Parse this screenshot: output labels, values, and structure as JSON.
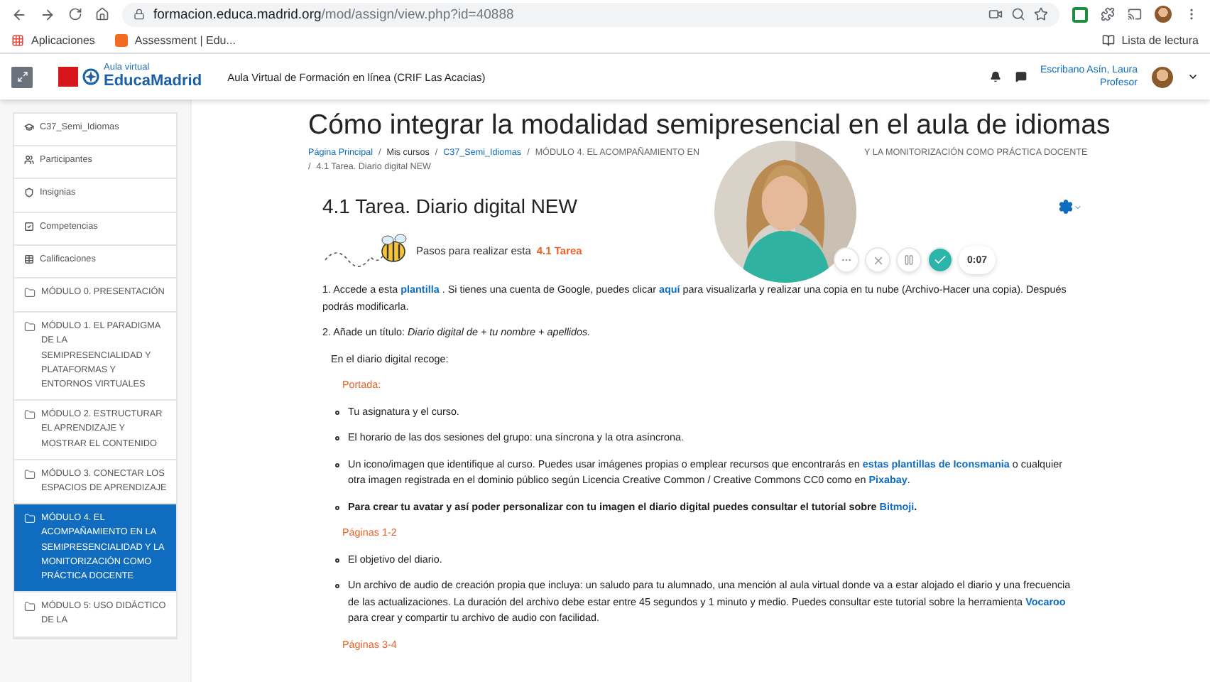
{
  "browser": {
    "url_domain": "formacion.educa.madrid.org",
    "url_path": "/mod/assign/view.php?id=40888",
    "bookmarks": [
      {
        "label": "Aplicaciones",
        "kind": "apps"
      },
      {
        "label": "Assessment | Edu...",
        "kind": "site"
      }
    ],
    "reading_list": "Lista de lectura"
  },
  "navbar": {
    "logo_small": "Aula virtual",
    "logo_big": "EducaMadrid",
    "site_name": "Aula Virtual de Formación en línea (CRIF Las Acacias)",
    "user_name": "Escribano Asín, Laura",
    "user_role": "Profesor"
  },
  "sidebar": {
    "items": [
      {
        "label": "C37_Semi_Idiomas",
        "kind": "course",
        "selected": false
      },
      {
        "label": "Participantes",
        "kind": "people",
        "selected": false
      },
      {
        "label": "Insignias",
        "kind": "badge",
        "selected": false
      },
      {
        "label": "Competencias",
        "kind": "check",
        "selected": false
      },
      {
        "label": "Calificaciones",
        "kind": "grades",
        "selected": false
      },
      {
        "label": "MÓDULO 0. PRESENTACIÓN",
        "kind": "folder",
        "selected": false
      },
      {
        "label": "MÓDULO 1. EL PARADIGMA DE LA SEMIPRESENCIALIDAD Y PLATAFORMAS Y ENTORNOS VIRTUALES",
        "kind": "folder",
        "selected": false
      },
      {
        "label": "MÓDULO 2. ESTRUCTURAR EL APRENDIZAJE Y MOSTRAR EL CONTENIDO",
        "kind": "folder",
        "selected": false
      },
      {
        "label": "MÓDULO 3. CONECTAR LOS ESPACIOS DE APRENDIZAJE",
        "kind": "folder",
        "selected": false
      },
      {
        "label": "MÓDULO 4. EL ACOMPAÑAMIENTO EN LA SEMIPRESENCIALIDAD Y LA MONITORIZACIÓN COMO PRÁCTICA DOCENTE",
        "kind": "folder",
        "selected": true
      },
      {
        "label": "MÓDULO 5: USO DIDÁCTICO DE LA",
        "kind": "folder",
        "selected": false
      }
    ]
  },
  "page": {
    "title": "Cómo integrar la modalidad semipresencial en el aula de idiomas",
    "breadcrumb_separator": "/",
    "breadcrumb": [
      {
        "label": "Página Principal",
        "kind": "link"
      },
      {
        "label": "Mis cursos",
        "kind": "plain"
      },
      {
        "label": "C37_Semi_Idiomas",
        "kind": "link"
      },
      {
        "label": "MÓDULO 4. EL ACOMPAÑAMIENTO EN",
        "kind": "muted"
      },
      {
        "label": "Y LA MONITORIZACIÓN COMO PRÁCTICA DOCENTE",
        "kind": "tail"
      },
      {
        "label": "4.1 Tarea. Diario digital NEW",
        "kind": "muted"
      }
    ],
    "activity_title": "4.1 Tarea. Diario digital NEW",
    "steps_text": "Pasos para realizar esta",
    "steps_link": "4.1 Tarea",
    "blocks": [
      {
        "kind": "para",
        "segments": [
          {
            "kind": "text",
            "text": "1. Accede a esta"
          },
          {
            "kind": "link",
            "text": "plantilla"
          },
          {
            "kind": "text",
            "text": ". Si tienes una cuenta de Google, puedes clicar"
          },
          {
            "kind": "link",
            "text": "aquí"
          },
          {
            "kind": "text",
            "text": "para visualizarla y realizar una copia en tu nube (Archivo-Hacer una copia). Después podrás modificarla."
          }
        ]
      },
      {
        "kind": "para",
        "segments": [
          {
            "kind": "text",
            "text": "2. Añade un título:"
          },
          {
            "kind": "em",
            "text": "Diario digital de + tu nombre + apellidos."
          }
        ]
      },
      {
        "kind": "sub",
        "segments": [
          {
            "kind": "text",
            "text": "En el diario digital recoge:"
          }
        ]
      },
      {
        "kind": "heading",
        "segments": [
          {
            "kind": "text",
            "text": "Portada:"
          }
        ]
      },
      {
        "kind": "bullet",
        "segments": [
          {
            "kind": "text",
            "text": "Tu asignatura y el curso."
          }
        ]
      },
      {
        "kind": "bullet",
        "segments": [
          {
            "kind": "text",
            "text": "El horario de las dos sesiones del grupo: una síncrona y  la otra asíncrona."
          }
        ]
      },
      {
        "kind": "bullet",
        "segments": [
          {
            "kind": "text",
            "text": "Un icono/imagen que identifique al curso. Puedes usar imágenes propias o emplear recursos  que encontrarás en"
          },
          {
            "kind": "link",
            "text": "estas plantillas de Iconsmania"
          },
          {
            "kind": "text",
            "text": "o cualquier otra imagen registrada en el dominio público según Licencia Creative Common / Creative Commons CC0 como en"
          },
          {
            "kind": "link",
            "text": "Pixabay"
          },
          {
            "kind": "text",
            "text": "."
          }
        ]
      },
      {
        "kind": "boldbullet",
        "segments": [
          {
            "kind": "text",
            "text": "Para crear tu avatar y así poder personalizar con tu imagen el diario digital puedes consultar el tutorial sobre"
          },
          {
            "kind": "link",
            "text": "Bitmoji"
          },
          {
            "kind": "text",
            "text": "."
          }
        ]
      },
      {
        "kind": "heading",
        "segments": [
          {
            "kind": "text",
            "text": "Páginas 1-2"
          }
        ]
      },
      {
        "kind": "bullet",
        "segments": [
          {
            "kind": "text",
            "text": "El objetivo del diario."
          }
        ]
      },
      {
        "kind": "bullet",
        "segments": [
          {
            "kind": "text",
            "text": "Un archivo de audio de creación propia que incluya:  un saludo para tu alumnado, una mención al aula virtual donde va a estar alojado el diario y una frecuencia de las actualizaciones. La duración del archivo debe estar entre 45 segundos y 1 minuto y medio. Puedes consultar este tutorial sobre la herramienta"
          },
          {
            "kind": "link",
            "text": "Vocaroo"
          },
          {
            "kind": "text",
            "text": "para crear y compartir tu archivo de audio con facilidad."
          }
        ]
      },
      {
        "kind": "heading",
        "segments": [
          {
            "kind": "text",
            "text": "Páginas 3-4"
          }
        ]
      }
    ]
  },
  "recorder": {
    "time": "0:07"
  }
}
